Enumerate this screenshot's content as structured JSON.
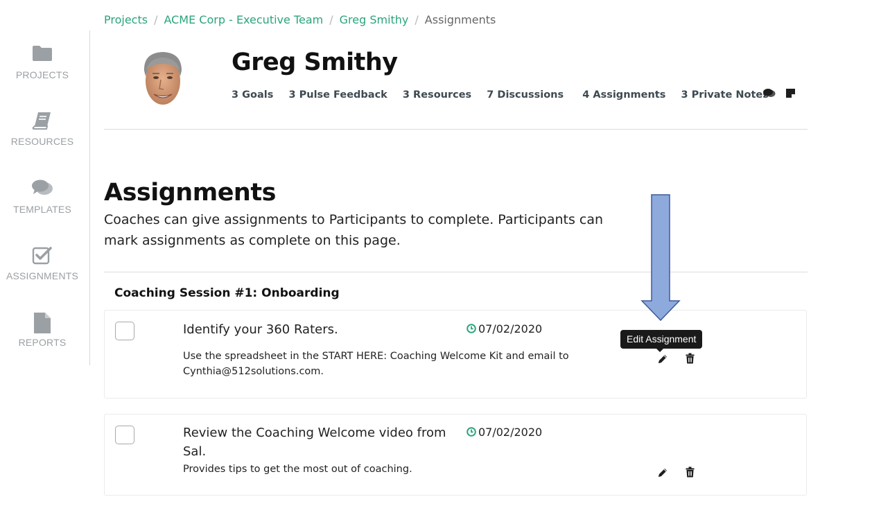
{
  "breadcrumb": {
    "items": [
      "Projects",
      "ACME Corp - Executive Team",
      "Greg Smithy"
    ],
    "current": "Assignments",
    "separator": "/"
  },
  "sidebar": {
    "items": [
      {
        "label": "PROJECTS",
        "icon": "folder-icon"
      },
      {
        "label": "RESOURCES",
        "icon": "book-icon"
      },
      {
        "label": "TEMPLATES",
        "icon": "comments-icon"
      },
      {
        "label": "ASSIGNMENTS",
        "icon": "checked-box-icon"
      },
      {
        "label": "REPORTS",
        "icon": "document-icon"
      }
    ]
  },
  "profile": {
    "name": "Greg Smithy",
    "stats": [
      "3 Goals",
      "3 Pulse Feedback",
      "3 Resources",
      "7 Discussions",
      "4 Assignments",
      "3 Private Notes"
    ],
    "header_icons": [
      "comments-icon",
      "sticky-note-icon"
    ]
  },
  "page": {
    "title": "Assignments",
    "description": "Coaches can give assignments to Participants to complete. Participants can mark assignments as complete on this page."
  },
  "session": {
    "title": "Coaching Session #1: Onboarding",
    "assignments": [
      {
        "title": "Identify your 360 Raters.",
        "date": "07/02/2020",
        "note": "Use the spreadsheet in the START HERE: Coaching Welcome Kit and email to Cynthia@512solutions.com.",
        "completed": false
      },
      {
        "title": "Review the Coaching Welcome video from Sal.",
        "date": "07/02/2020",
        "note": "Provides tips to get the most out of coaching.",
        "completed": false
      }
    ]
  },
  "tooltip": {
    "text": "Edit Assignment"
  },
  "colors": {
    "link": "#2aa57a",
    "stat_text": "#3d4a52",
    "sidebar_icon": "#9aa0a4",
    "annotation_arrow_fill": "#8ea9dc",
    "annotation_arrow_stroke": "#3d5a9a"
  }
}
